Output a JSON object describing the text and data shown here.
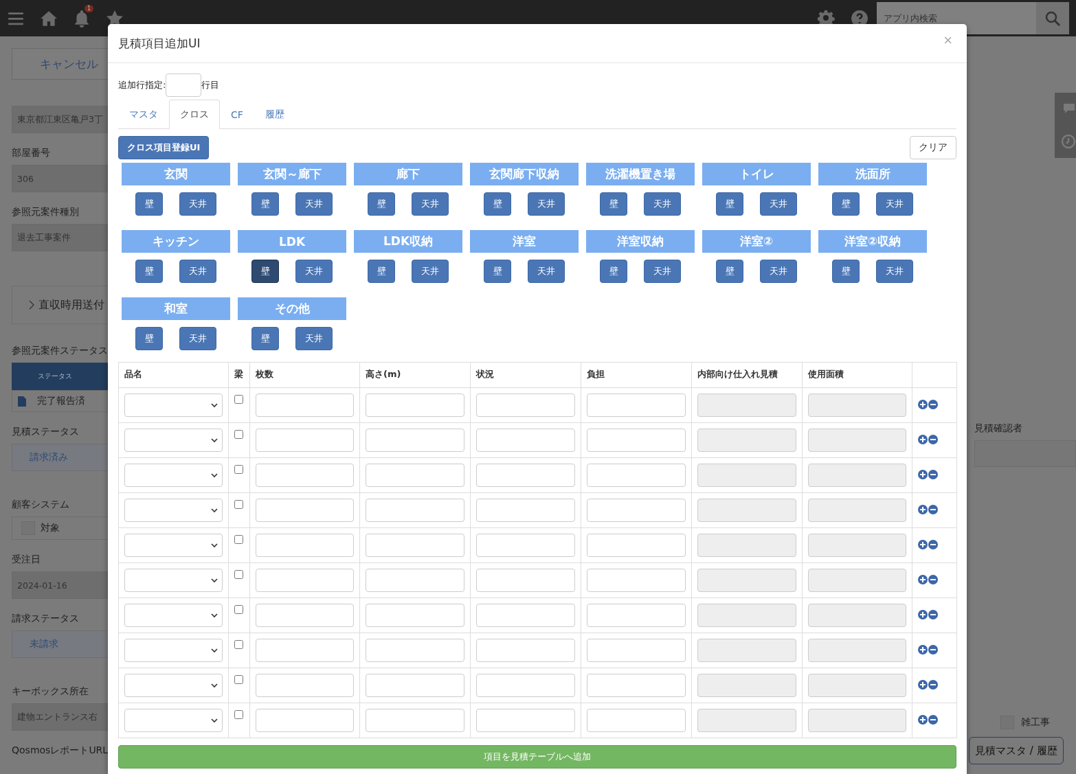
{
  "topbar": {
    "notification_count": "1",
    "search": {
      "placeholder": "アプリ内検索"
    }
  },
  "background": {
    "cancel_button": "キャンセル",
    "left": [
      {
        "kind": "field",
        "value": "東京都江東区亀戸3丁"
      },
      {
        "kind": "label",
        "text": "部屋番号"
      },
      {
        "kind": "field",
        "value": "306"
      },
      {
        "kind": "label",
        "text": "参照元案件種別"
      },
      {
        "kind": "field",
        "value": "退去工事案件"
      },
      {
        "kind": "disclosure",
        "text": "直収時用送付"
      },
      {
        "kind": "label",
        "text": "参照元案件ステータス"
      },
      {
        "kind": "status_table",
        "header": "ステータス",
        "value": "完了報告済"
      },
      {
        "kind": "label",
        "text": "見積ステータス"
      },
      {
        "kind": "link_field",
        "value": "請求済み"
      },
      {
        "kind": "label",
        "text": "顧客システム"
      },
      {
        "kind": "checkbox",
        "text": "対象",
        "checked": false
      },
      {
        "kind": "label",
        "text": "受注日"
      },
      {
        "kind": "field",
        "value": "2024-01-16"
      },
      {
        "kind": "label",
        "text": "請求ステータス"
      },
      {
        "kind": "link_field",
        "value": "未請求"
      },
      {
        "kind": "label",
        "text": "キーボックス所在"
      },
      {
        "kind": "field",
        "value": "建物エントランス右"
      },
      {
        "kind": "label",
        "text": "QosmosレポートURL"
      }
    ],
    "right": {
      "label": "見積確認者",
      "checkbox": {
        "text": "雑工事",
        "checked": false
      },
      "button": "見積マスタ / 履歴"
    }
  },
  "modal": {
    "title": "見積項目追加UI",
    "close": "×",
    "row_spec": {
      "label": "追加行指定:",
      "suffix": "行目"
    },
    "tabs": [
      {
        "label": "マスタ",
        "selected": false
      },
      {
        "label": "クロス",
        "selected": true
      },
      {
        "label": "CF",
        "selected": false
      },
      {
        "label": "履歴",
        "selected": false
      }
    ],
    "register_button": "クロス項目登録UI",
    "clear_button": "クリア",
    "rooms": [
      {
        "name": "玄関",
        "buttons": [
          {
            "label": "壁",
            "selected": false
          },
          {
            "label": "天井",
            "selected": false
          }
        ]
      },
      {
        "name": "玄関～廊下",
        "buttons": [
          {
            "label": "壁",
            "selected": false
          },
          {
            "label": "天井",
            "selected": false
          }
        ]
      },
      {
        "name": "廊下",
        "buttons": [
          {
            "label": "壁",
            "selected": false
          },
          {
            "label": "天井",
            "selected": false
          }
        ]
      },
      {
        "name": "玄関廊下収納",
        "buttons": [
          {
            "label": "壁",
            "selected": false
          },
          {
            "label": "天井",
            "selected": false
          }
        ]
      },
      {
        "name": "洗濯機置き場",
        "buttons": [
          {
            "label": "壁",
            "selected": false
          },
          {
            "label": "天井",
            "selected": false
          }
        ]
      },
      {
        "name": "トイレ",
        "buttons": [
          {
            "label": "壁",
            "selected": false
          },
          {
            "label": "天井",
            "selected": false
          }
        ]
      },
      {
        "name": "洗面所",
        "buttons": [
          {
            "label": "壁",
            "selected": false
          },
          {
            "label": "天井",
            "selected": false
          }
        ]
      },
      {
        "name": "キッチン",
        "buttons": [
          {
            "label": "壁",
            "selected": false
          },
          {
            "label": "天井",
            "selected": false
          }
        ]
      },
      {
        "name": "LDK",
        "buttons": [
          {
            "label": "壁",
            "selected": true
          },
          {
            "label": "天井",
            "selected": false
          }
        ]
      },
      {
        "name": "LDK収納",
        "buttons": [
          {
            "label": "壁",
            "selected": false
          },
          {
            "label": "天井",
            "selected": false
          }
        ]
      },
      {
        "name": "洋室",
        "buttons": [
          {
            "label": "壁",
            "selected": false
          },
          {
            "label": "天井",
            "selected": false
          }
        ]
      },
      {
        "name": "洋室収納",
        "buttons": [
          {
            "label": "壁",
            "selected": false
          },
          {
            "label": "天井",
            "selected": false
          }
        ]
      },
      {
        "name": "洋室②",
        "buttons": [
          {
            "label": "壁",
            "selected": false
          },
          {
            "label": "天井",
            "selected": false
          }
        ]
      },
      {
        "name": "洋室②収納",
        "buttons": [
          {
            "label": "壁",
            "selected": false
          },
          {
            "label": "天井",
            "selected": false
          }
        ]
      },
      {
        "name": "和室",
        "buttons": [
          {
            "label": "壁",
            "selected": false
          },
          {
            "label": "天井",
            "selected": false
          }
        ]
      },
      {
        "name": "その他",
        "buttons": [
          {
            "label": "壁",
            "selected": false
          },
          {
            "label": "天井",
            "selected": false
          }
        ]
      }
    ],
    "table": {
      "columns": [
        "品名",
        "梁",
        "枚数",
        "高さ(m)",
        "状況",
        "負担",
        "内部向け仕入れ見積",
        "使用面積"
      ],
      "rows": [
        {
          "checked": false
        },
        {
          "checked": false
        },
        {
          "checked": false
        },
        {
          "checked": false
        },
        {
          "checked": false
        },
        {
          "checked": false
        },
        {
          "checked": false
        },
        {
          "checked": false
        },
        {
          "checked": false
        },
        {
          "checked": false
        }
      ]
    },
    "submit_button": "項目を見積テーブルへ追加"
  }
}
